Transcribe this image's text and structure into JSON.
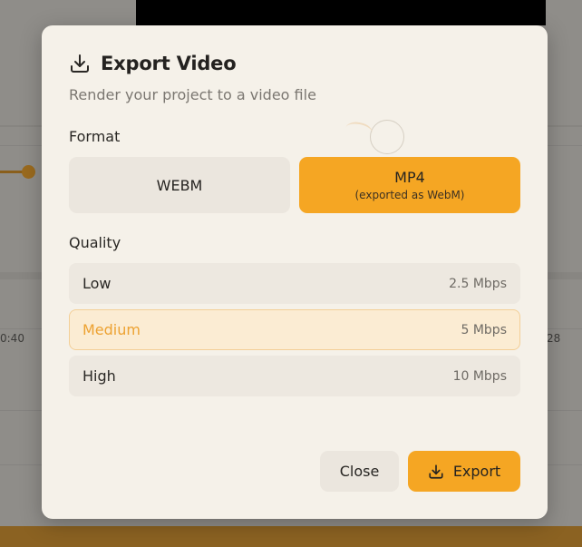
{
  "background": {
    "time_left": "0:40",
    "time_right": "28"
  },
  "dialog": {
    "title": "Export Video",
    "subtitle": "Render your project to a video file",
    "icon": "download-icon"
  },
  "format": {
    "label": "Format",
    "options": [
      {
        "label": "WEBM",
        "note": "",
        "selected": false
      },
      {
        "label": "MP4",
        "note": "(exported as WebM)",
        "selected": true
      }
    ]
  },
  "quality": {
    "label": "Quality",
    "options": [
      {
        "label": "Low",
        "rate": "2.5 Mbps",
        "selected": false
      },
      {
        "label": "Medium",
        "rate": "5 Mbps",
        "selected": true
      },
      {
        "label": "High",
        "rate": "10 Mbps",
        "selected": false
      }
    ]
  },
  "actions": {
    "close_label": "Close",
    "export_label": "Export"
  },
  "colors": {
    "accent": "#f5a623",
    "selected_bg": "#fbecd3",
    "selected_text": "#eda232",
    "dialog_bg": "#f5f1e9"
  }
}
